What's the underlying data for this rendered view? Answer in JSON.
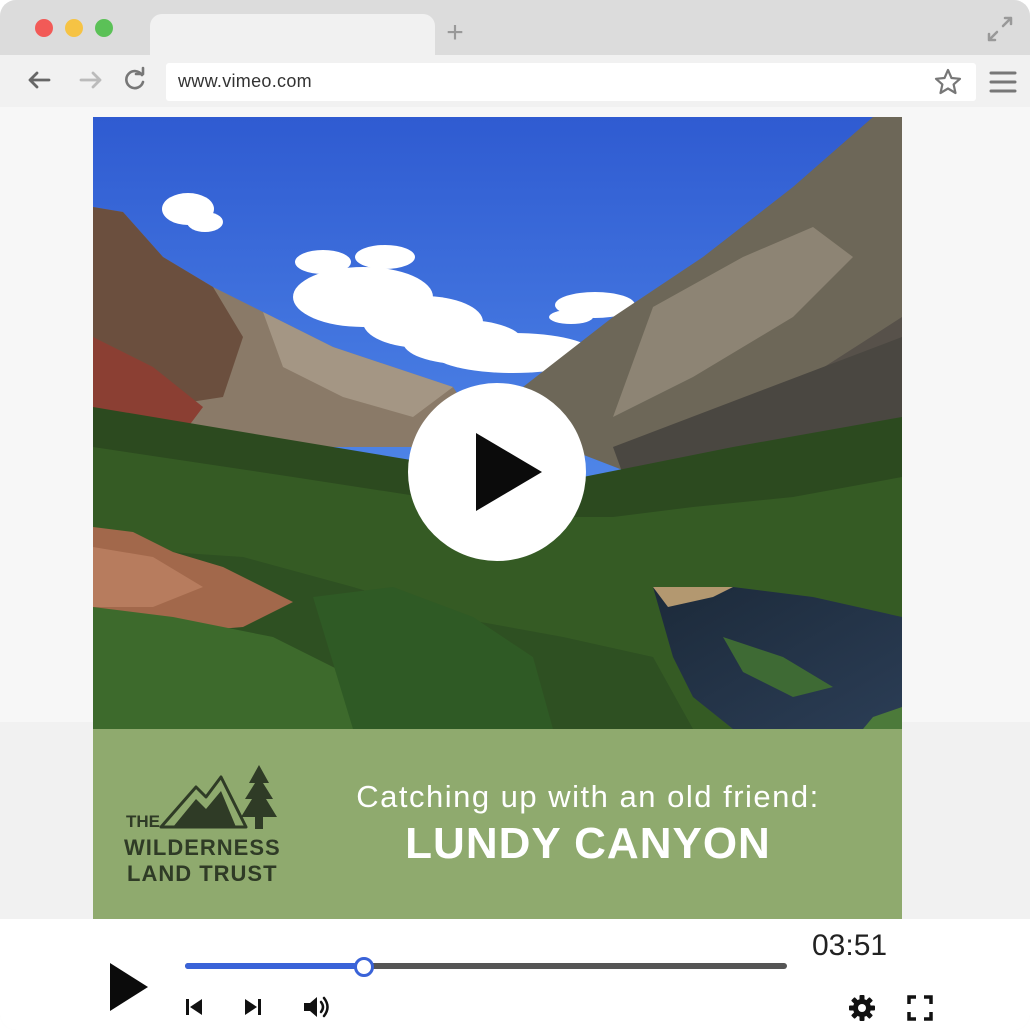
{
  "browser": {
    "url": "www.vimeo.com",
    "new_tab_symbol": "+"
  },
  "icons": {
    "back": "arrow-left-icon",
    "forward": "arrow-right-icon",
    "reload": "reload-icon",
    "bookmark": "star-icon",
    "menu": "hamburger-menu-icon",
    "resize": "expand-icon",
    "play": "play-icon",
    "skip_back": "skip-back-icon",
    "skip_forward": "skip-forward-icon",
    "volume": "volume-icon",
    "settings": "gear-icon",
    "fullscreen": "fullscreen-icon"
  },
  "video": {
    "banner_subtitle": "Catching up with an old friend:",
    "banner_title": "LUNDY CANYON",
    "logo": {
      "line1": "THE",
      "line2": "WILDERNESS",
      "line3": "LAND TRUST"
    }
  },
  "player": {
    "time": "03:51",
    "progress": 0.297
  },
  "colors": {
    "progress": "#3a63d8",
    "banner": "#8faa6e",
    "logo_ink": "#2f3b26"
  }
}
